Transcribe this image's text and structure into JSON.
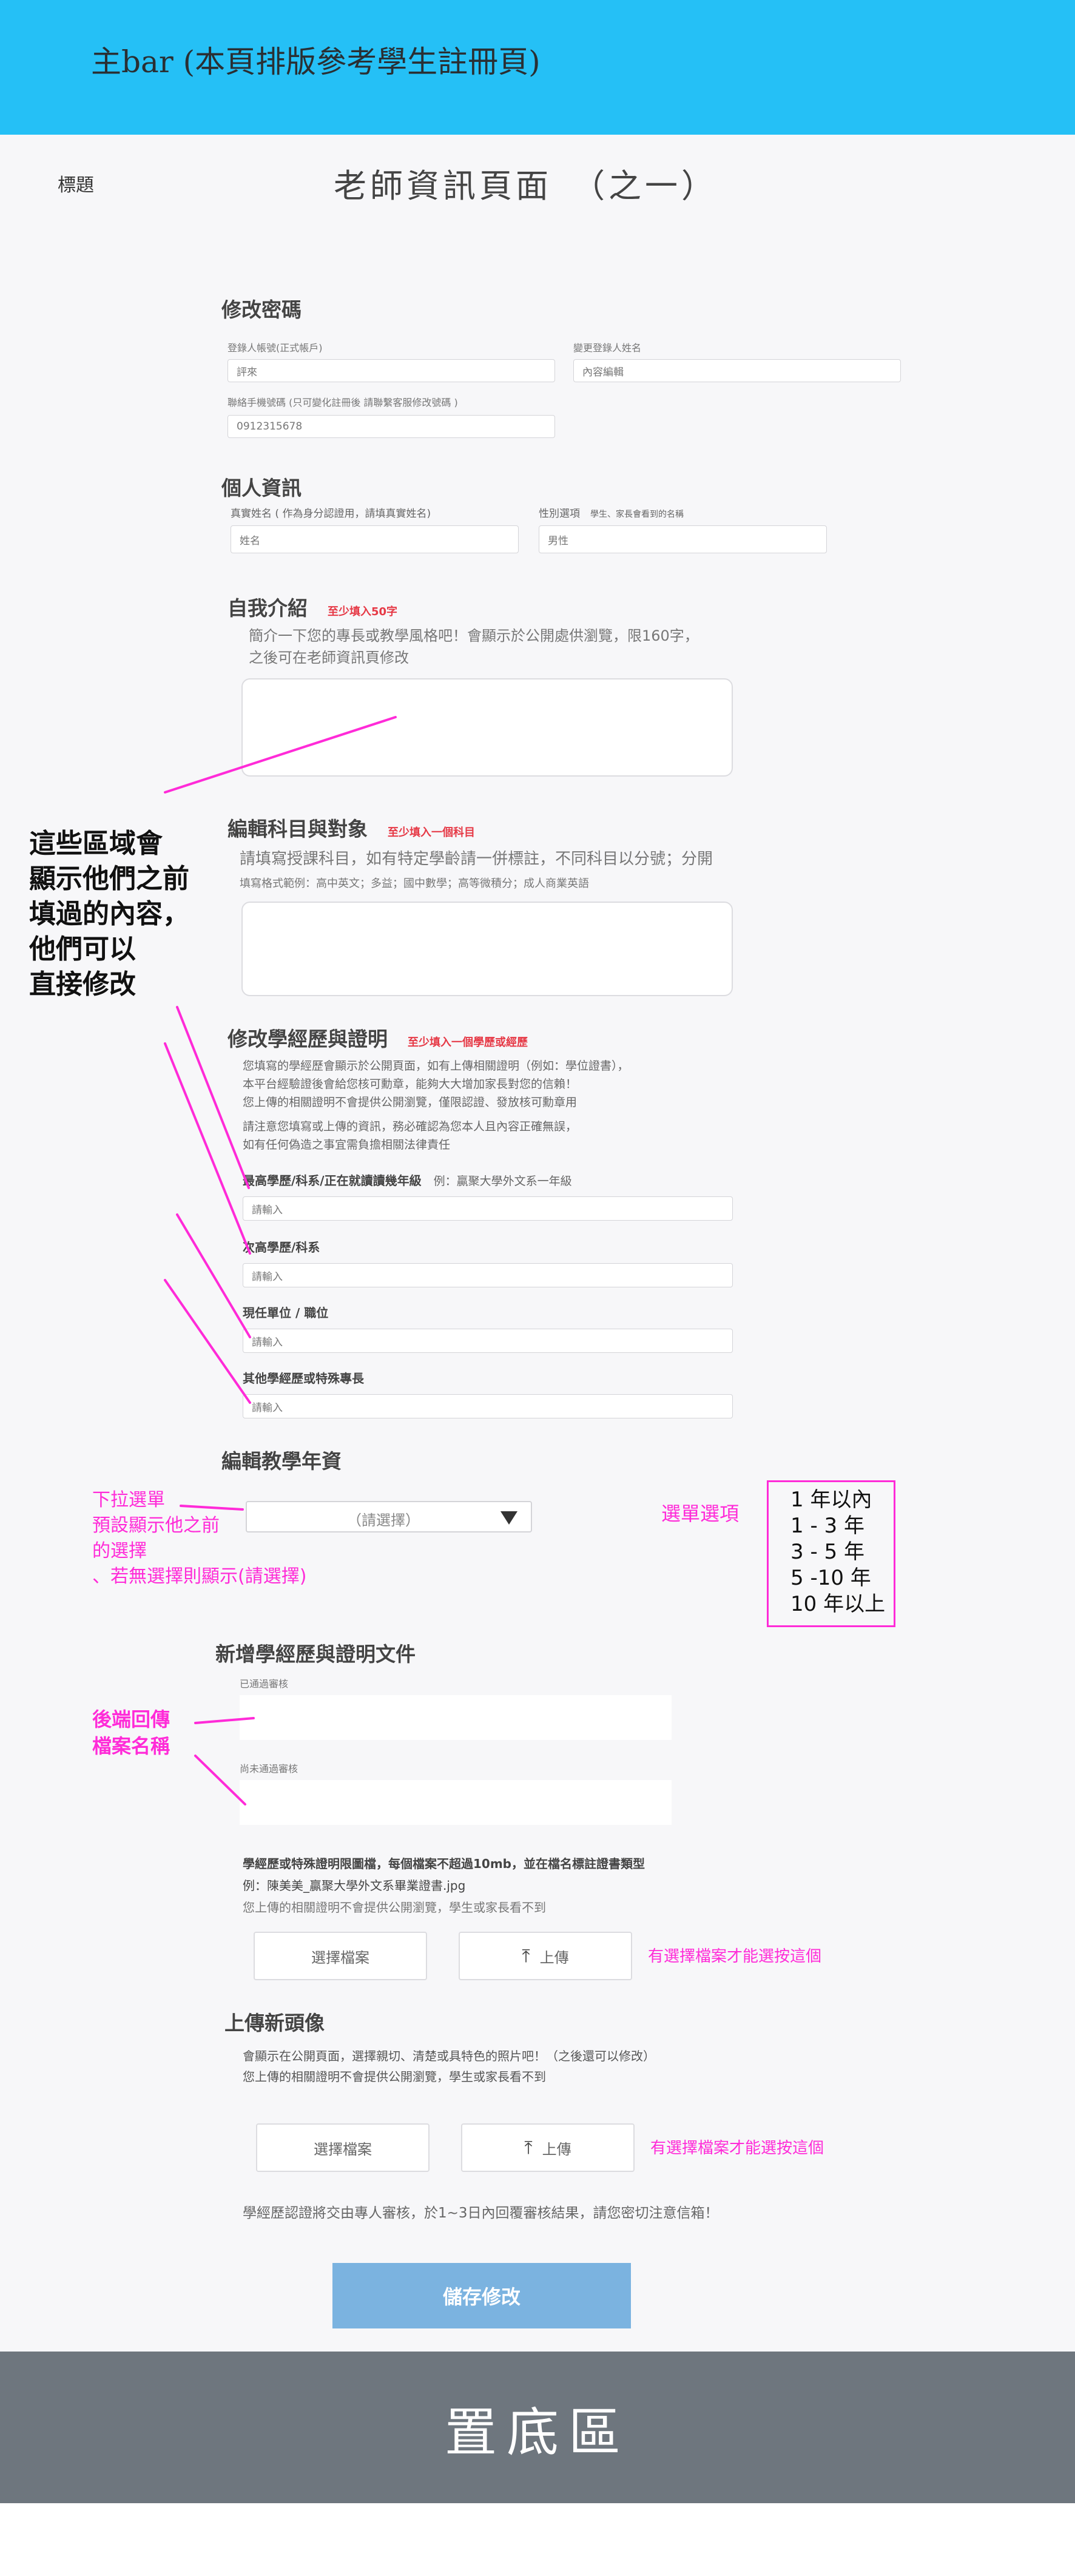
{
  "topbar": {
    "title": "主bar (本頁排版參考學生註冊頁)"
  },
  "header": {
    "label": "標題",
    "title": "老師資訊頁面　（之一）"
  },
  "password": {
    "section": "修改密碼",
    "field1_label": "登錄人帳號(正式帳戶)",
    "field1_value": "評來",
    "field2_label": "變更登錄人姓名",
    "field2_value": "內容編輯",
    "field3_label": "聯絡手機號碼 (只可變化註冊後 請聯繫客服修改號碼 )",
    "field3_value": "0912315678"
  },
  "personal": {
    "section": "個人資訊",
    "name_label": "真實姓名 ( 作為身分認證用，請填真實姓名)",
    "name_value": "姓名",
    "gender_label": "性別選項",
    "gender_hint": "學生、家長會看到的名稱",
    "gender_value": "男性"
  },
  "intro": {
    "title": "自我介紹",
    "required": "至少填入50字",
    "desc_line1": "簡介一下您的專長或教學風格吧！會顯示於公開處供瀏覽，限160字，",
    "desc_line2": "之後可在老師資訊頁修改"
  },
  "subjects": {
    "title": "編輯科目與對象",
    "required": "至少填入一個科目",
    "desc": "請填寫授課科目，如有特定學齡請一併標註，不同科目以分號；分開",
    "example": "填寫格式範例：高中英文；多益；國中數學；高等微積分；成人商業英語"
  },
  "education": {
    "title": "修改學經歷與證明",
    "required": "至少填入一個學歷或經歷",
    "desc_line1": "您填寫的學經歷會顯示於公開頁面，如有上傳相關證明（例如：學位證書），",
    "desc_line2": "本平台經驗證後會給您核可勳章，能夠大大增加家長對您的信賴！",
    "desc_line3": "您上傳的相關證明不會提供公開瀏覽，僅限認證、發放核可勳章用",
    "desc_line4": "請注意您填寫或上傳的資訊，務必確認為您本人且內容正確無誤，",
    "desc_line5": "如有任何偽造之事宜需負擔相關法律責任",
    "field1_label": "最高學歷/科系/正在就讀讀幾年級",
    "field1_example": "例：贏聚大學外文系一年級",
    "field1_ph": "請輸入",
    "field2_label": "次高學歷/科系",
    "field2_ph": "請輸入",
    "field3_label": "現任單位 / 職位",
    "field3_ph": "請輸入",
    "field4_label": "其他學經歷或特殊專長",
    "field4_ph": "請輸入"
  },
  "years": {
    "title": "編輯教學年資",
    "select_placeholder": "（請選擇）",
    "options_label": "選單選項",
    "options": [
      "1 年以內",
      "1 - 3 年",
      "3 - 5 年",
      "5 -10 年",
      "10 年以上"
    ]
  },
  "docs": {
    "title": "新增學經歷與證明文件",
    "approved_label": "已通過審核",
    "pending_label": "尚未通過審核",
    "rule": "學經歷或特殊證明限圖檔，每個檔案不超過10mb，並在檔名標註證書類型",
    "example": "例：陳美美_贏聚大學外文系畢業證書.jpg",
    "privacy": "您上傳的相關證明不會提供公開瀏覽，學生或家長看不到",
    "choose_button": "選擇檔案",
    "upload_button": "上傳",
    "note": "有選擇檔案才能選按這個"
  },
  "avatar": {
    "title": "上傳新頭像",
    "desc_line1": "會顯示在公開頁面，選擇親切、清楚或具特色的照片吧！（之後還可以修改）",
    "desc_line2": "您上傳的相關證明不會提供公開瀏覽，學生或家長看不到",
    "choose_button": "選擇檔案",
    "upload_button": "上傳",
    "note": "有選擇檔案才能選按這個"
  },
  "review_note": "學經歷認證將交由專人審核，於1~3日內回覆審核結果，請您密切注意信箱！",
  "save_button": "儲存修改",
  "annotations": {
    "area_line1": "這些區域會",
    "area_line2": "顯示他們之前",
    "area_line3": "填過的內容，",
    "area_line4": "他們可以",
    "area_line5": "直接修改",
    "dropdown_line1": "下拉選單",
    "dropdown_line2": "預設顯示他之前",
    "dropdown_line3": "的選擇",
    "dropdown_line4": "、若無選擇則顯示(請選擇)",
    "backend_line1": "後端回傳",
    "backend_line2": "檔案名稱"
  },
  "footer": {
    "text": "置底區"
  },
  "colors": {
    "topbar": "#25c0f6",
    "annotation": "#ff2bd8",
    "save_button": "#7bb3e0",
    "footer": "#6e767e",
    "required": "#e63946"
  }
}
